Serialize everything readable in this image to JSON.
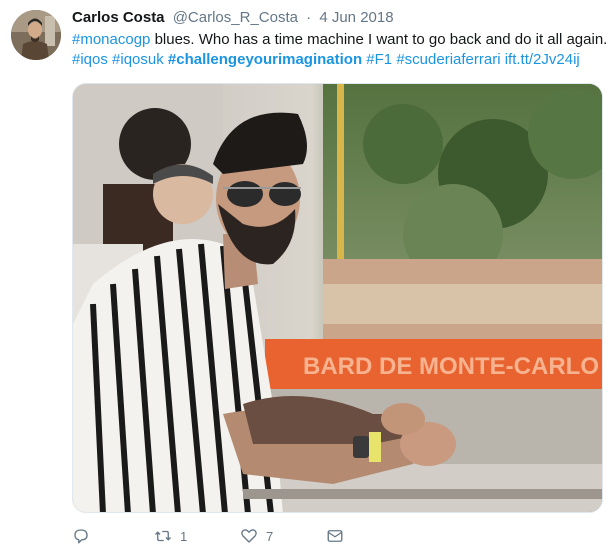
{
  "author": {
    "name": "Carlos Costa",
    "handle": "@Carlos_R_Costa",
    "separator": "·",
    "date": "4 Jun 2018"
  },
  "tweet": {
    "line1": {
      "tag": "#monacogp",
      "text": " blues. Who has a time machine I want to go back and do it all again."
    },
    "line2": {
      "tags": [
        "#iqos",
        "#iqosuk"
      ],
      "bold_tag": "#challengeyourimagination",
      "tags_after": [
        "#F1",
        "#scuderiaferrari"
      ],
      "link": "ift.tt/2Jv24ij"
    }
  },
  "media": {
    "sign_text": "BARD DE MONTE-CARLO"
  },
  "actions": {
    "reply_icon": "reply-icon",
    "retweet_icon": "retweet-icon",
    "retweet_count": "1",
    "like_icon": "heart-icon",
    "like_count": "7",
    "dm_icon": "envelope-icon"
  },
  "colors": {
    "link": "#1b95e0",
    "muted": "#657786",
    "text": "#14171a"
  }
}
